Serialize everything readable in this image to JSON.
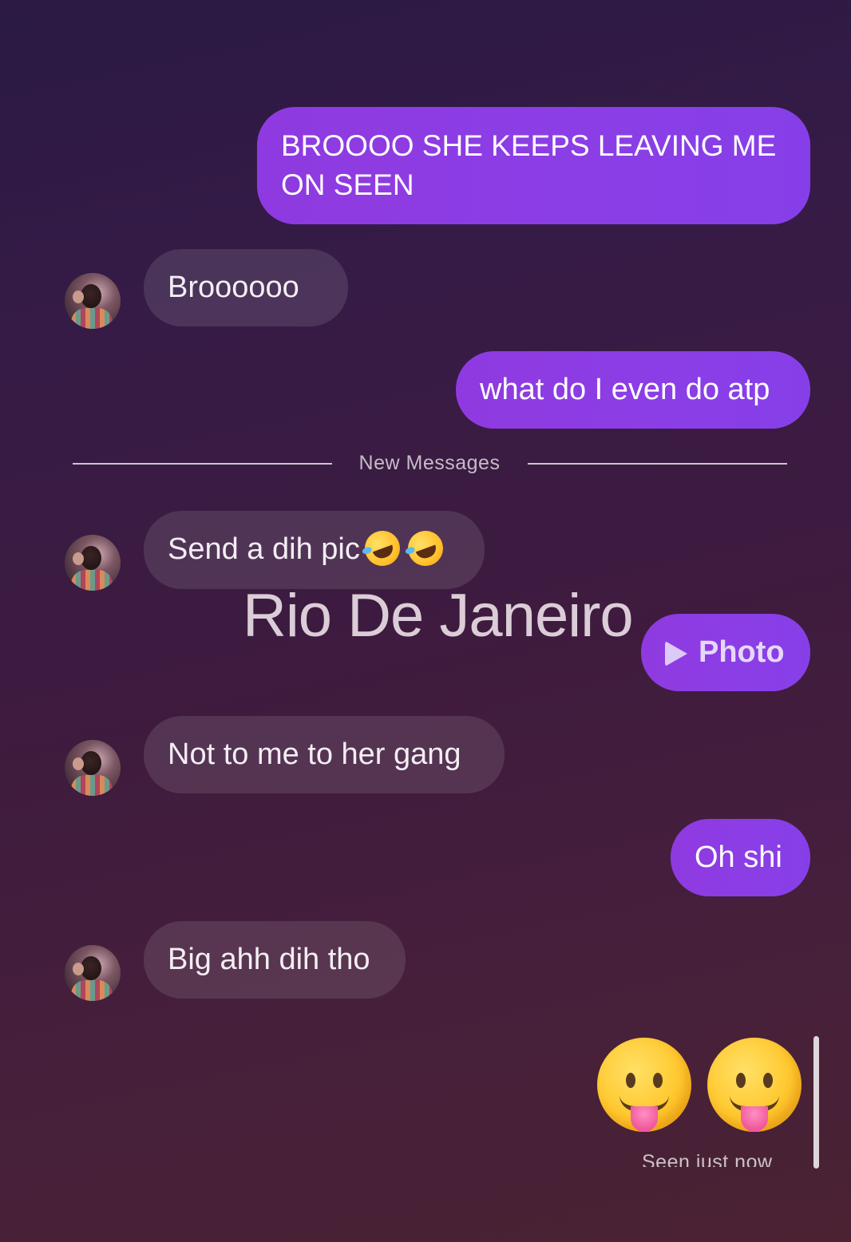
{
  "messages": {
    "m1": "BROOOO SHE KEEPS LEAVING ME ON SEEN",
    "m2": "Broooooo",
    "m3": "what do I even do atp",
    "m4": "Send a dih pic",
    "m5": "Not to me to her gang",
    "m6": "Oh shi",
    "m7": "Big ahh dih tho"
  },
  "divider": {
    "label": "New Messages"
  },
  "sticker": {
    "text": "Rio De Janeiro"
  },
  "photo_bubble": {
    "label": "Photo"
  },
  "emojis": {
    "m4_reaction_icons": [
      "rolling-on-floor-laughing",
      "rolling-on-floor-laughing"
    ],
    "last_sent_icons": [
      "face-with-tongue",
      "face-with-tongue"
    ]
  },
  "status": {
    "seen": "Seen just now"
  },
  "colors": {
    "sent_bubble": "#8b3ee6",
    "received_bubble": "rgba(255,255,255,0.11)",
    "background_top": "#2a1a44",
    "background_bottom": "#4a2232"
  }
}
